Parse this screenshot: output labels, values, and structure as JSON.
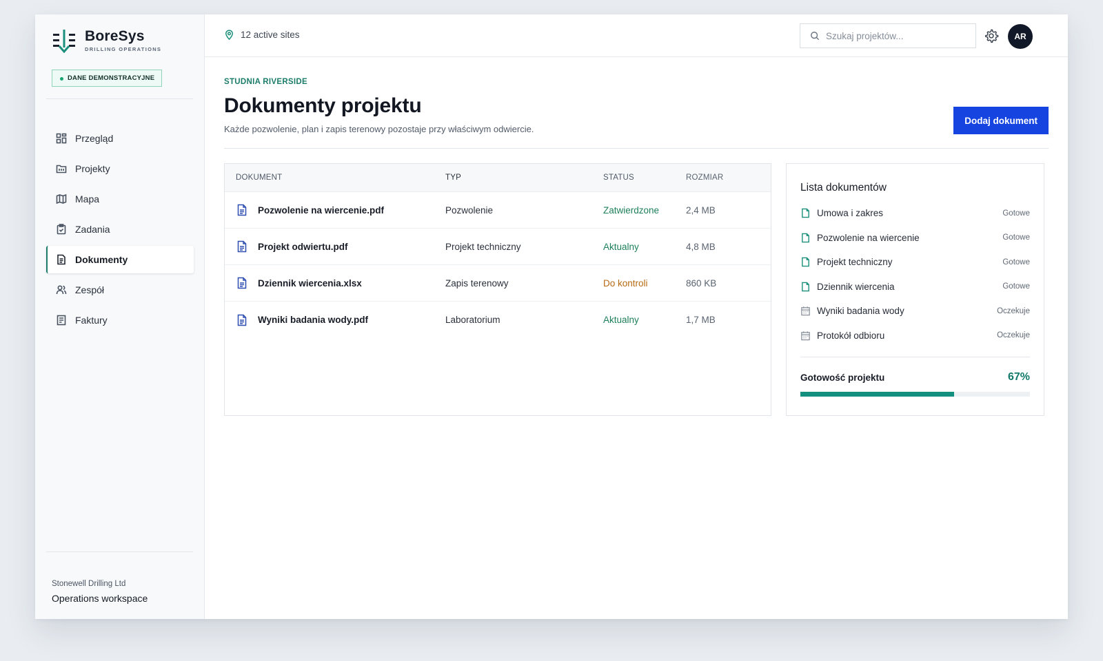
{
  "brand": {
    "name": "BoreSys",
    "subtitle": "DRILLING OPERATIONS"
  },
  "demo_badge": "DANE DEMONSTRACYJNE",
  "sidebar": {
    "items": [
      {
        "label": "Przegląd",
        "icon": "grid-icon",
        "active": false
      },
      {
        "label": "Projekty",
        "icon": "folder-icon",
        "active": false
      },
      {
        "label": "Mapa",
        "icon": "map-icon",
        "active": false
      },
      {
        "label": "Zadania",
        "icon": "clipboard-icon",
        "active": false
      },
      {
        "label": "Dokumenty",
        "icon": "document-icon",
        "active": true
      },
      {
        "label": "Zespół",
        "icon": "users-icon",
        "active": false
      },
      {
        "label": "Faktury",
        "icon": "receipt-icon",
        "active": false
      }
    ],
    "organization": "Stonewell Drilling Ltd",
    "workspace": "Operations workspace"
  },
  "topbar": {
    "sites": "12 active sites",
    "search_placeholder": "Szukaj projektów...",
    "avatar_initials": "AR"
  },
  "page": {
    "breadcrumb": "STUDNIA RIVERSIDE",
    "title": "Dokumenty projektu",
    "subtitle": "Każde pozwolenie, plan i zapis terenowy pozostaje przy właściwym odwiercie.",
    "add_button": "Dodaj dokument"
  },
  "table": {
    "headers": {
      "document": "DOKUMENT",
      "type": "TYP",
      "status": "STATUS",
      "size": "ROZMIAR"
    },
    "rows": [
      {
        "name": "Pozwolenie na wiercenie.pdf",
        "type": "Pozwolenie",
        "status": "Zatwierdzone",
        "size": "2,4 MB"
      },
      {
        "name": "Projekt odwiertu.pdf",
        "type": "Projekt techniczny",
        "status": "Aktualny",
        "size": "4,8 MB"
      },
      {
        "name": "Dziennik wiercenia.xlsx",
        "type": "Zapis terenowy",
        "status": "Do kontroli",
        "size": "860 KB"
      },
      {
        "name": "Wyniki badania wody.pdf",
        "type": "Laboratorium",
        "status": "Aktualny",
        "size": "1,7 MB"
      }
    ]
  },
  "checklist": {
    "title": "Lista dokumentów",
    "items": [
      {
        "label": "Umowa i zakres",
        "state": "Gotowe",
        "icon": "file-check-icon"
      },
      {
        "label": "Pozwolenie na wiercenie",
        "state": "Gotowe",
        "icon": "file-check-icon"
      },
      {
        "label": "Projekt techniczny",
        "state": "Gotowe",
        "icon": "file-check-icon"
      },
      {
        "label": "Dziennik wiercenia",
        "state": "Gotowe",
        "icon": "file-check-icon"
      },
      {
        "label": "Wyniki badania wody",
        "state": "Oczekuje",
        "icon": "calendar-icon"
      },
      {
        "label": "Protokół odbioru",
        "state": "Oczekuje",
        "icon": "calendar-icon"
      }
    ],
    "readiness_label": "Gotowość projektu",
    "readiness_value": "67%",
    "readiness_fraction": 0.67
  },
  "colors": {
    "accent": "#1b7c6a",
    "primary_button": "#1544e0",
    "status_ok": "#1d7f5a",
    "status_review": "#b66a12",
    "progress": "#139080"
  }
}
